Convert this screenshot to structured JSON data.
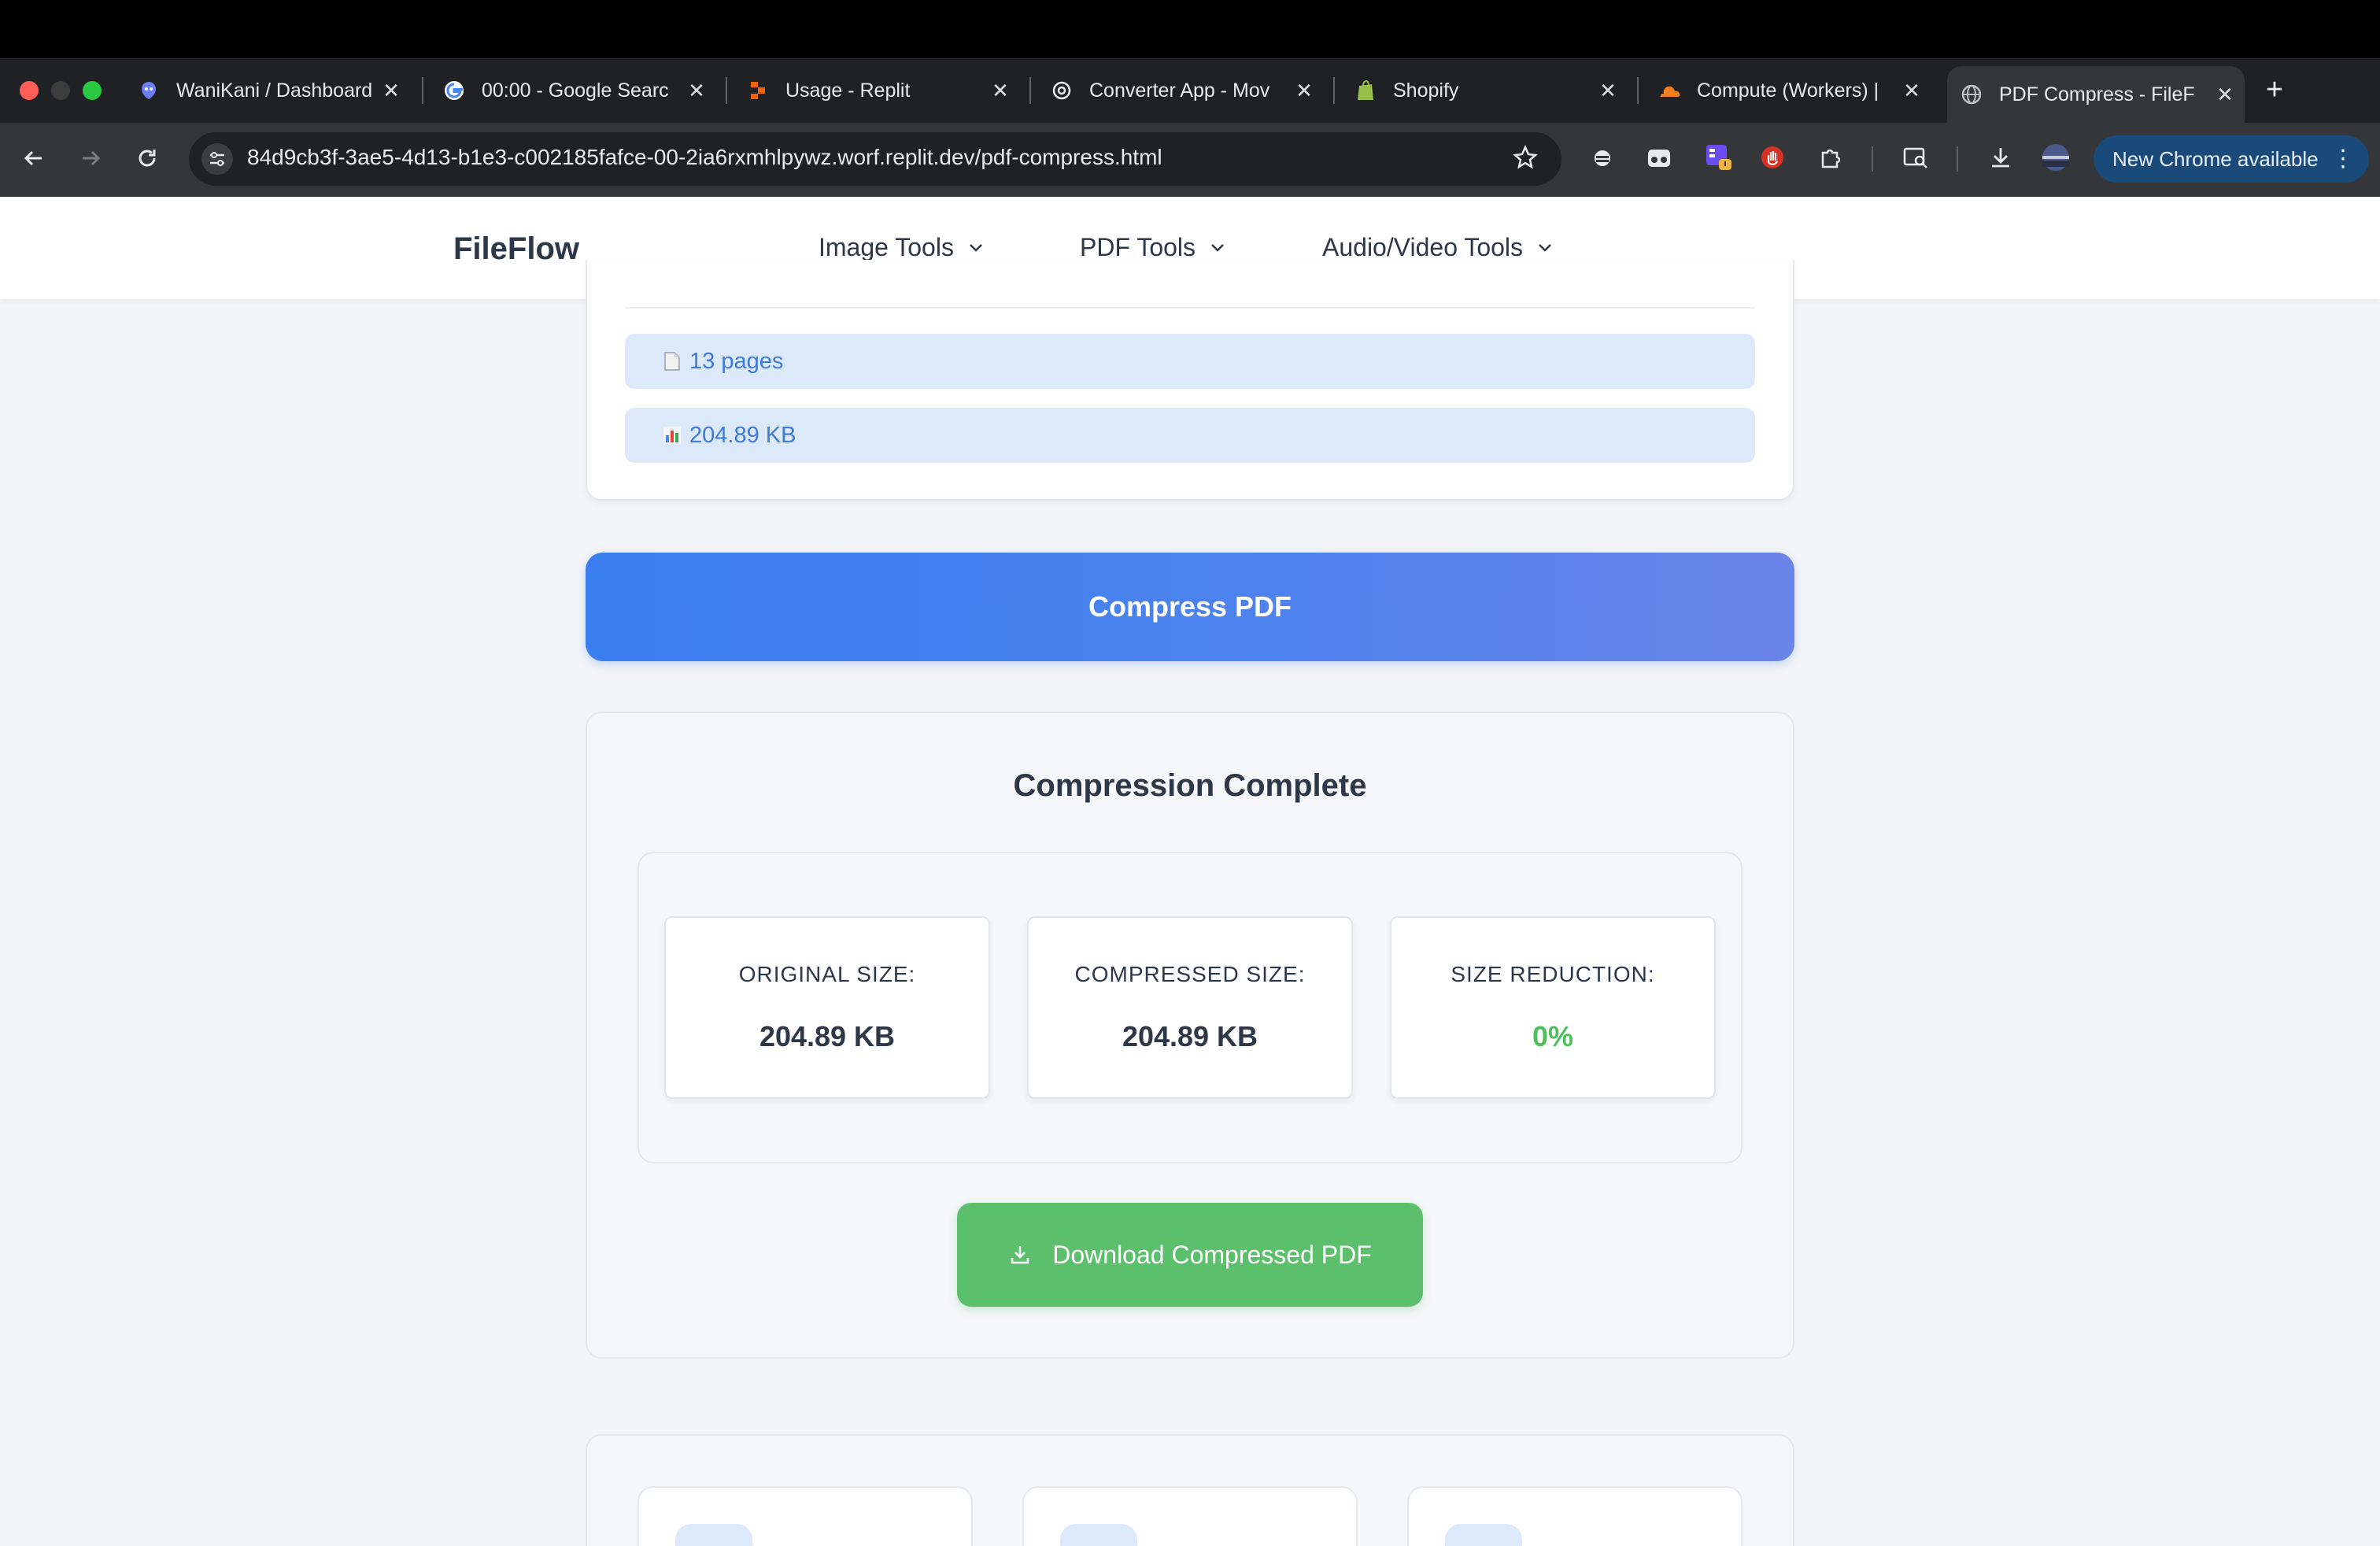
{
  "browser": {
    "tabs": [
      {
        "title": "WaniKani / Dashboard",
        "icon": "wanikani-icon"
      },
      {
        "title": "00:00 - Google Searc",
        "icon": "google-icon"
      },
      {
        "title": "Usage - Replit",
        "icon": "replit-icon"
      },
      {
        "title": "Converter App - Mov",
        "icon": "openai-icon"
      },
      {
        "title": "Shopify",
        "icon": "shopify-icon"
      },
      {
        "title": "Compute (Workers) |",
        "icon": "cloudflare-icon"
      },
      {
        "title": "PDF Compress - FileF",
        "icon": "globe-icon",
        "active": true
      }
    ],
    "url": "84d9cb3f-3ae5-4d13-b1e3-c002185fafce-00-2ia6rxmhlpywz.worf.replit.dev/pdf-compress.html",
    "update_label": "New Chrome available"
  },
  "site": {
    "logo": "FileFlow",
    "nav": [
      {
        "label": "Image Tools"
      },
      {
        "label": "PDF Tools"
      },
      {
        "label": "Audio/Video Tools"
      }
    ]
  },
  "file_info": {
    "pages": "13 pages",
    "size": "204.89 KB"
  },
  "compress_button": "Compress PDF",
  "result": {
    "title": "Compression Complete",
    "stats": [
      {
        "label": "ORIGINAL SIZE:",
        "value": "204.89 KB"
      },
      {
        "label": "COMPRESSED SIZE:",
        "value": "204.89 KB"
      },
      {
        "label": "SIZE REDUCTION:",
        "value": "0%"
      }
    ],
    "download_button": "Download Compressed PDF"
  },
  "colors": {
    "accent_blue": "#3b7ef0",
    "success_green": "#5cbf6b",
    "info_pill_bg": "#dce9fb"
  }
}
